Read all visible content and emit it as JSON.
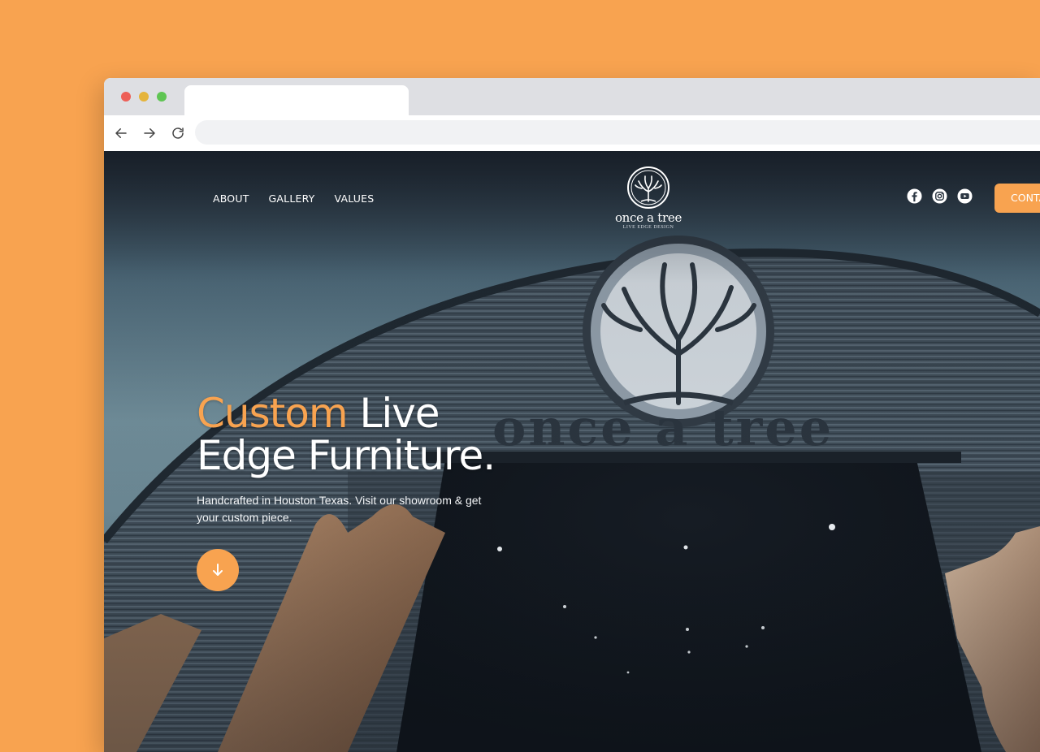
{
  "browser": {
    "tab_title": "",
    "address": "",
    "controls": {
      "back_icon": "arrow-left-icon",
      "forward_icon": "arrow-right-icon",
      "reload_icon": "reload-icon"
    }
  },
  "site": {
    "nav": [
      {
        "label": "ABOUT"
      },
      {
        "label": "GALLERY"
      },
      {
        "label": "VALUES"
      }
    ],
    "logo": {
      "name": "once a tree",
      "tagline": "LIVE EDGE DESIGN",
      "icon": "tree-logo-icon"
    },
    "social": [
      {
        "icon": "facebook-icon"
      },
      {
        "icon": "instagram-icon"
      },
      {
        "icon": "youtube-icon"
      }
    ],
    "contact_label": "CONTACT",
    "hero": {
      "headline_accent": "Custom",
      "headline_rest_line1": " Live",
      "headline_line2": "Edge Furniture.",
      "subtext": "Handcrafted in Houston Texas. Visit our showroom & get your custom piece.",
      "scroll_icon": "arrow-down-icon",
      "background_sign": "once a tree"
    }
  },
  "colors": {
    "page_background": "#F8A350",
    "accent": "#F8A350",
    "hero_dark": "#2c3743",
    "text_light": "#ffffff"
  }
}
